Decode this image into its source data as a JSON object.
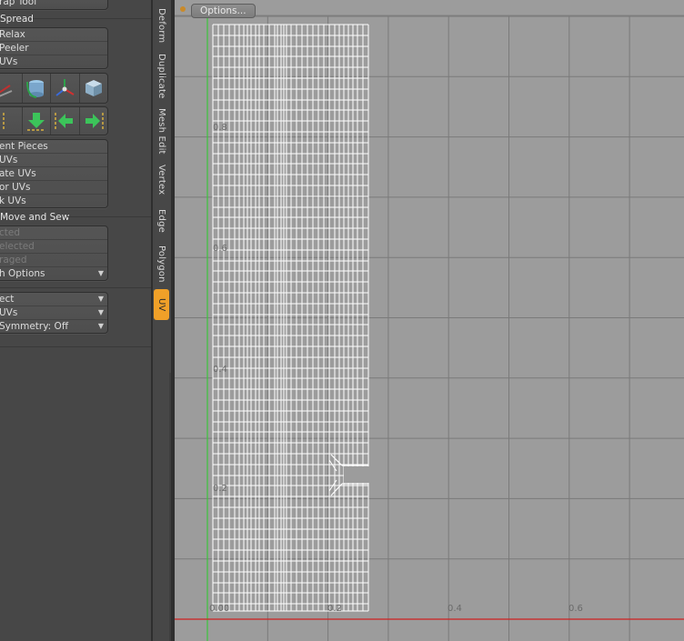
{
  "panel": {
    "wrap_tool": "rap Tool",
    "spread_title": "Spread",
    "spread_items": [
      "Relax",
      "Peeler",
      "UVs"
    ],
    "icon_row1": [
      "relax-tool-icon",
      "cylinder-projection-icon",
      "axis-gizmo-icon",
      "cube-projection-icon"
    ],
    "icon_row2": [
      "move-left-edge-icon",
      "move-down-icon",
      "move-left-icon",
      "move-right-icon"
    ],
    "pieces_items": [
      "ent Pieces",
      "UVs",
      "ate UVs",
      "or UVs",
      "k UVs"
    ],
    "move_sew_title": "Move and Sew",
    "move_sew_items": [
      {
        "label": "cted",
        "enabled": false
      },
      {
        "label": "elected",
        "enabled": false
      },
      {
        "label": "raged",
        "enabled": false
      },
      {
        "label": "h Options",
        "enabled": true
      }
    ],
    "select_items": [
      "ect",
      "UVs",
      "Symmetry: Off"
    ]
  },
  "tabs": [
    "Deform",
    "Duplicate",
    "Mesh Edit",
    "Vertex",
    "Edge",
    "Polygon",
    "UV"
  ],
  "active_tab": "UV",
  "viewport": {
    "options_label": "Options...",
    "y_labels": [
      "0.8",
      "0.6",
      "0.4",
      "0.2"
    ],
    "x_labels": [
      "0.00",
      "0.2",
      "0.4",
      "0.6"
    ],
    "colors": {
      "background": "#9c9c9c",
      "grid": "#7a7a7a",
      "x_axis": "#d02020",
      "y_axis": "#3cc43c",
      "wire": "#ffffff",
      "accent_tab": "#f0a028"
    }
  }
}
